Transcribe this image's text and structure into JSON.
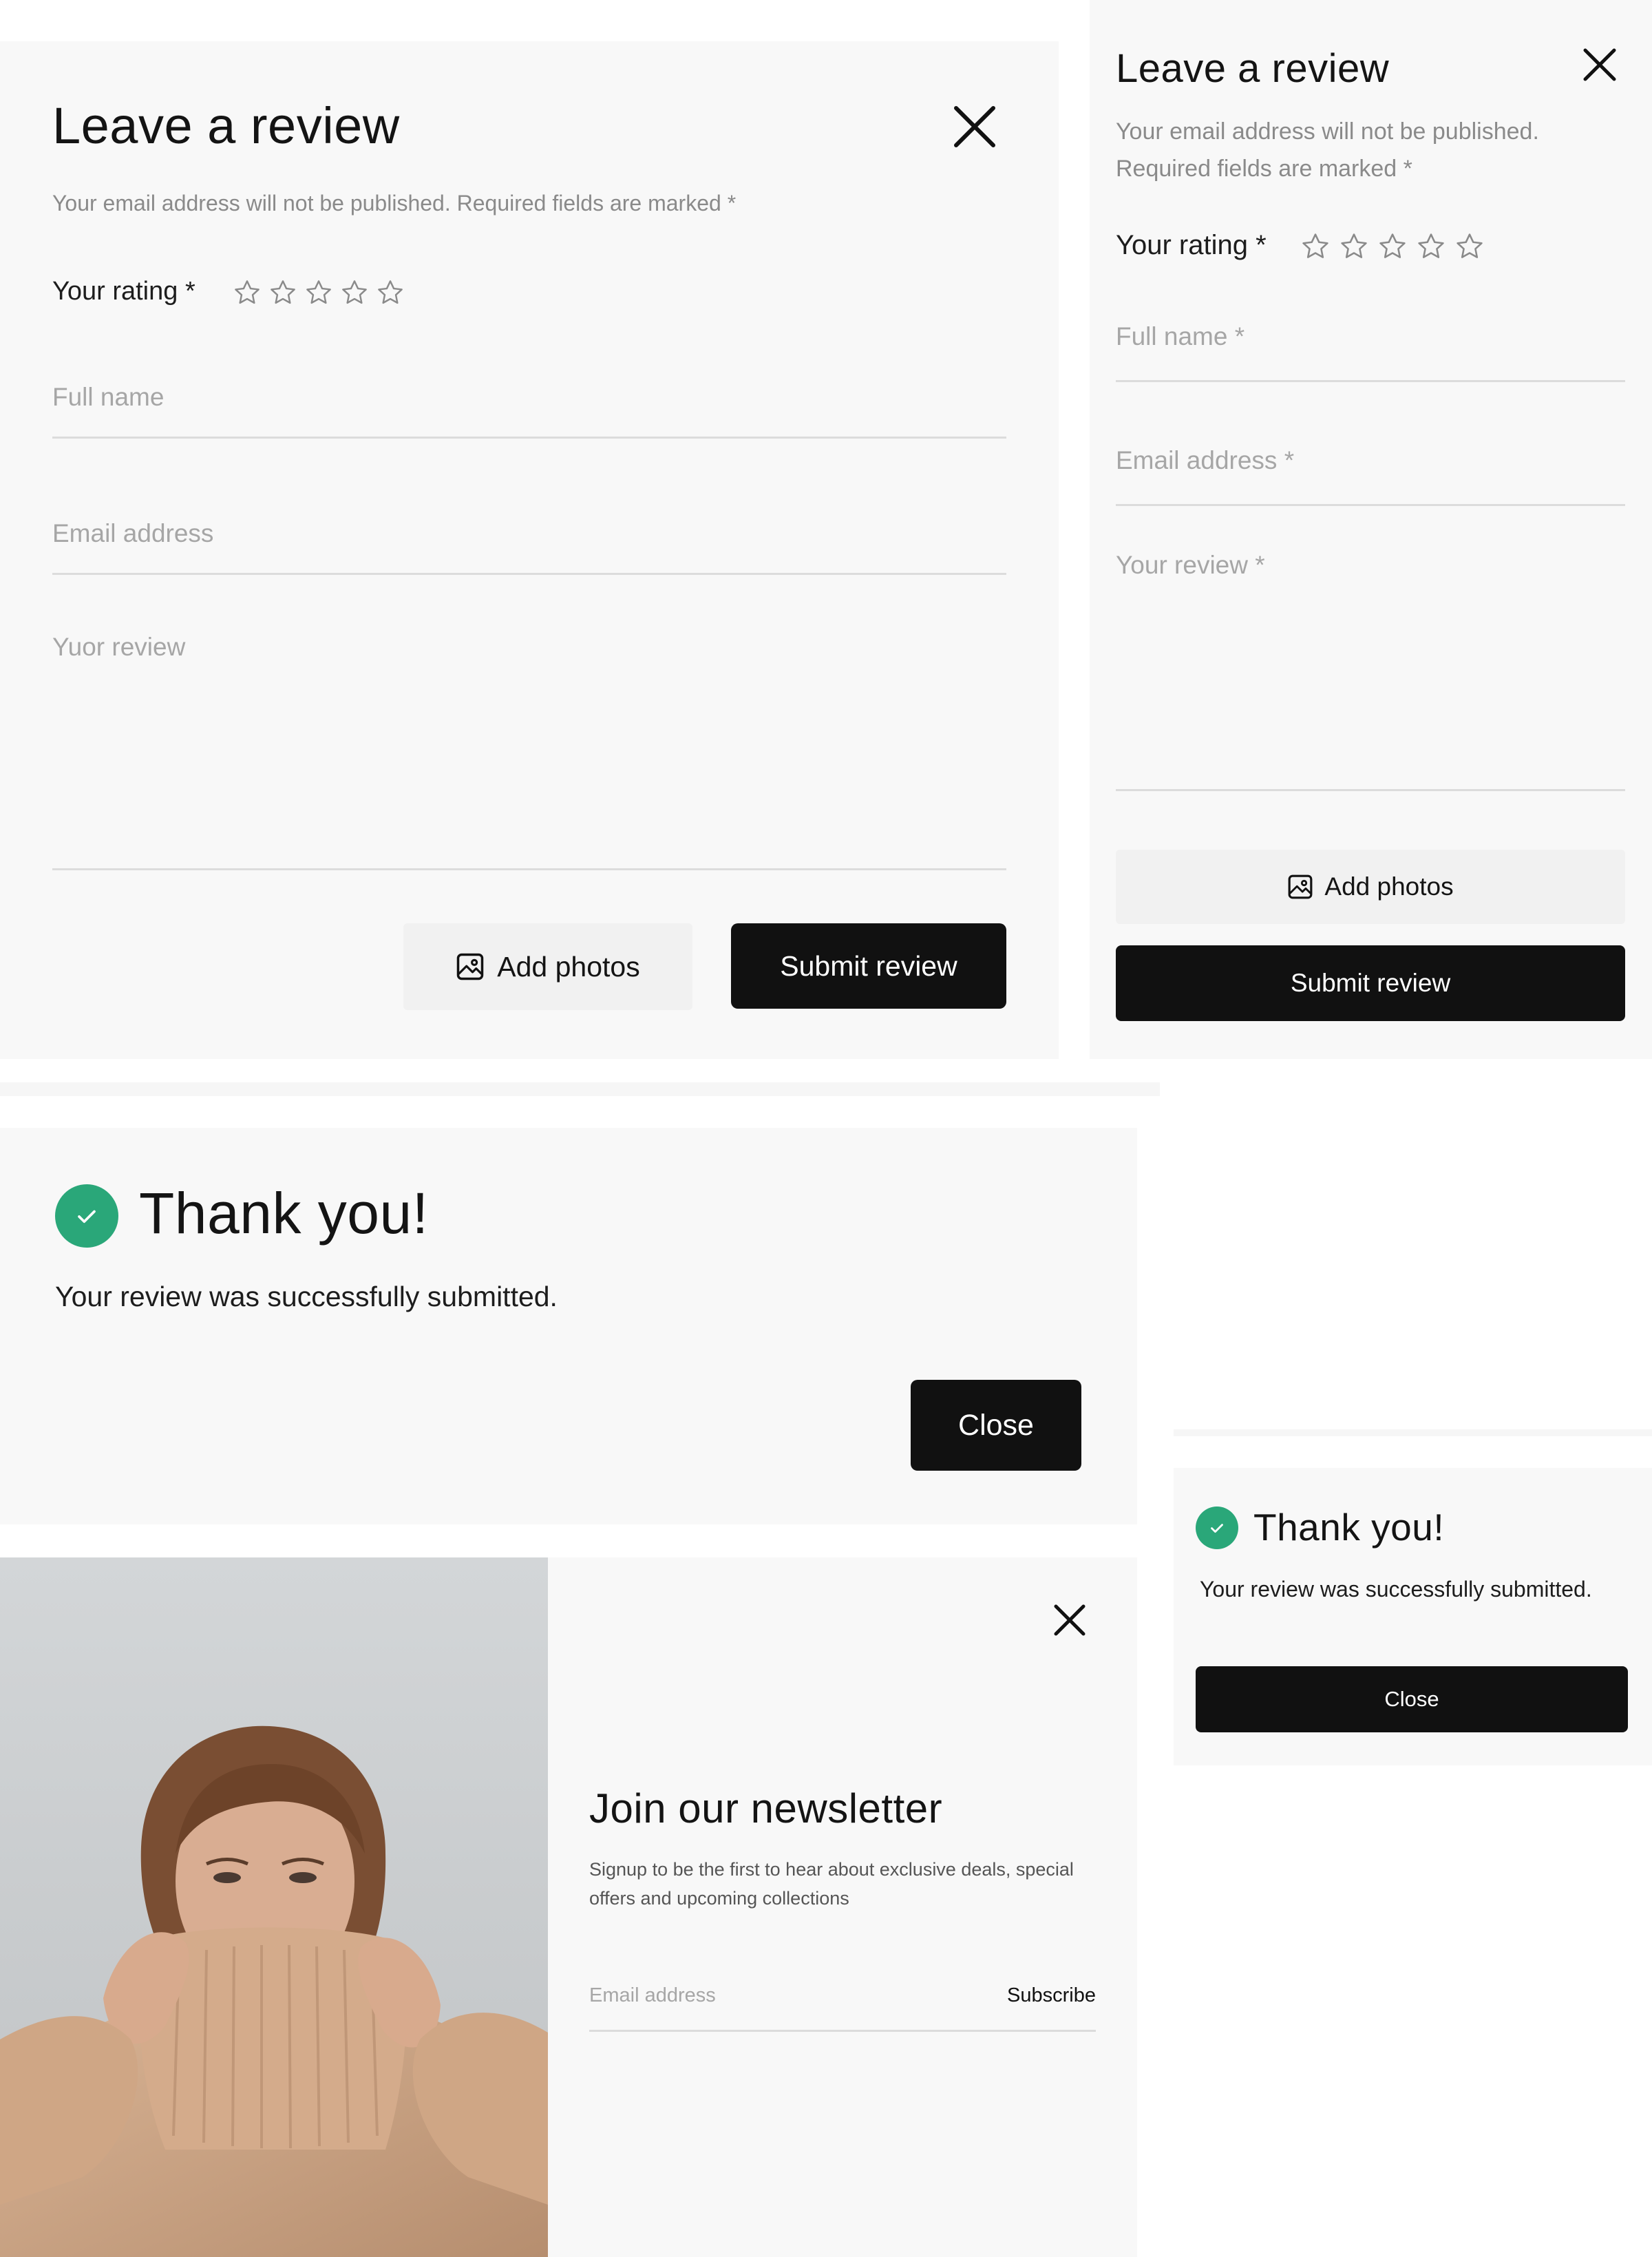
{
  "review_desktop": {
    "title": "Leave a review",
    "subtitle": "Your email address will not be published. Required fields are marked *",
    "rating_label": "Your rating *",
    "rating_value": 0,
    "rating_max": 5,
    "full_name_placeholder": "Full name",
    "email_placeholder": "Email address",
    "review_placeholder": "Yuor review",
    "add_photos_label": "Add photos",
    "submit_label": "Submit review"
  },
  "review_mobile": {
    "title": "Leave a review",
    "subtitle_line1": "Your email address will not be published.",
    "subtitle_line2": "Required fields are marked *",
    "rating_label": "Your rating *",
    "rating_value": 0,
    "rating_max": 5,
    "full_name_placeholder": "Full name *",
    "email_placeholder": "Email address  *",
    "review_placeholder": "Your review  *",
    "add_photos_label": "Add photos",
    "submit_label": "Submit review"
  },
  "thanks_desktop": {
    "title": "Thank you!",
    "message": "Your review was successfully submitted.",
    "close_label": "Close"
  },
  "thanks_mobile": {
    "title": "Thank you!",
    "message": "Your review was successfully submitted.",
    "close_label": "Close"
  },
  "newsletter": {
    "title": "Join our newsletter",
    "description_line1": "Signup to be the first to hear about exclusive deals, special",
    "description_line2": "offers and upcoming collections",
    "email_placeholder": "Email address",
    "subscribe_label": "Subscribe"
  },
  "colors": {
    "panel_bg": "#f8f8f8",
    "button_dark": "#111111",
    "success_green": "#2aa779",
    "divider": "#dcdcdc",
    "placeholder": "#a6a6a6"
  },
  "icons": {
    "close": "close-icon",
    "star": "star-outline-icon",
    "image": "image-icon",
    "check": "check-icon"
  }
}
